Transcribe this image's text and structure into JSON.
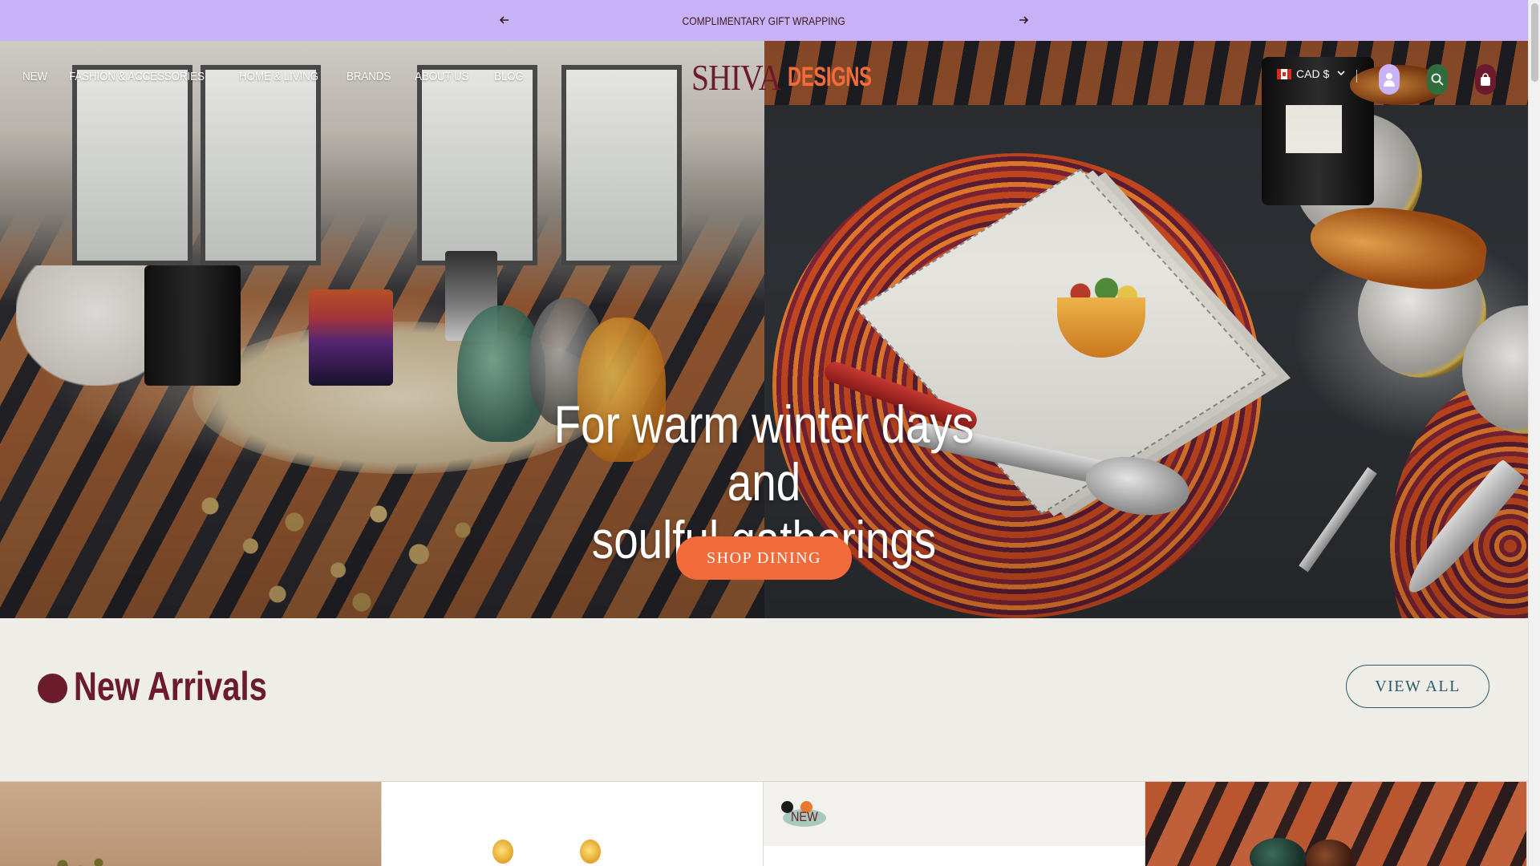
{
  "announcement": {
    "message": "COMPLIMENTARY GIFT WRAPPING",
    "prev_icon": "arrow-left-icon",
    "next_icon": "arrow-right-icon"
  },
  "nav": {
    "items": [
      {
        "label": "NEW"
      },
      {
        "label": "FASHION & ACCESSORIES"
      },
      {
        "label": "HOME & LIVING"
      },
      {
        "label": "BRANDS"
      },
      {
        "label": "ABOUT US"
      },
      {
        "label": "BLOG"
      }
    ]
  },
  "logo": {
    "part1": "SHIVA",
    "part2": "DESIGNS"
  },
  "header": {
    "currency": "CAD $",
    "currency_flag": "canada-flag-icon",
    "account_icon": "user-icon",
    "search_icon": "search-icon",
    "cart_icon": "bag-icon"
  },
  "hero": {
    "title_line1": "For warm winter days and",
    "title_line2": "soulful gatherings",
    "cta": "SHOP DINING"
  },
  "arrivals": {
    "heading": "New Arrivals",
    "view_all": "VIEW ALL"
  },
  "products": [
    {
      "badge": ""
    },
    {
      "badge": ""
    },
    {
      "badge": "NEW"
    },
    {
      "badge": ""
    }
  ],
  "colors": {
    "announcement_bg": "#c8b2f7",
    "brand_maroon": "#6b1b2b",
    "brand_orange": "#f26b3a",
    "section_bg": "#efede7",
    "button_outline": "#2b5a6b",
    "search_icon_bg": "#2f6e3c"
  }
}
